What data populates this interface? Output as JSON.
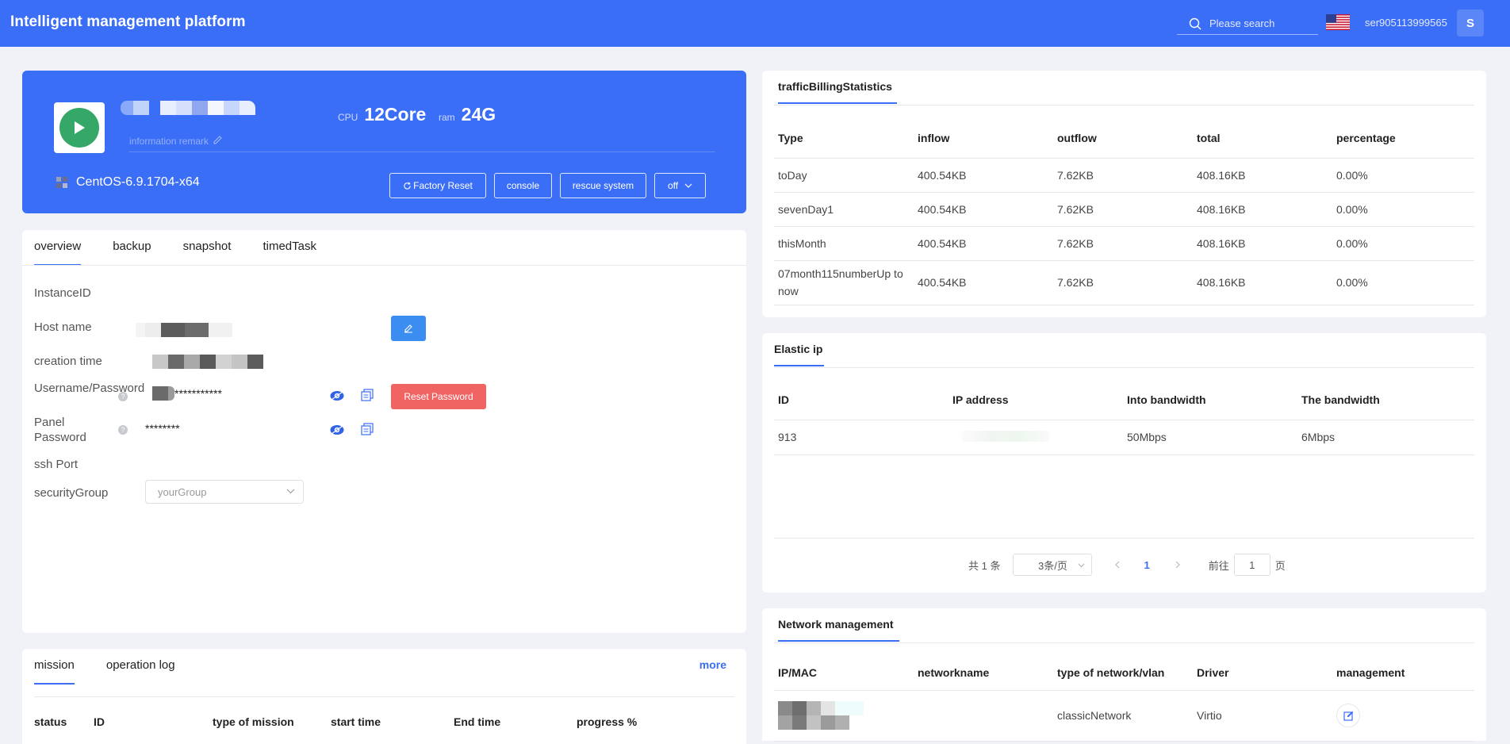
{
  "header": {
    "title": "Intelligent management platform",
    "search_placeholder": "Please search",
    "username": "ser905113999565",
    "avatar_letter": "S"
  },
  "instance": {
    "remark_label": "information remark",
    "cpu_label": "CPU",
    "cpu_value": "12Core",
    "ram_label": "ram",
    "ram_value": "24G",
    "os": "CentOS-6.9.1704-x64",
    "buttons": {
      "factory_reset": "Factory Reset",
      "console": "console",
      "rescue": "rescue system",
      "power": "off"
    }
  },
  "detail_tabs": [
    "overview",
    "backup",
    "snapshot",
    "timedTask"
  ],
  "overview": {
    "instance_id_label": "InstanceID",
    "host_name_label": "Host name",
    "creation_time_label": "creation time",
    "username_password_label": "Username/Password",
    "password_mask": "***********",
    "reset_password": "Reset Password",
    "panel_password_label": "Panel Password",
    "panel_password_mask": "********",
    "ssh_port_label": "ssh Port",
    "security_group_label": "securityGroup",
    "security_group_value": "yourGroup"
  },
  "mission_tabs": [
    "mission",
    "operation log"
  ],
  "mission_more": "more",
  "mission_columns": [
    "status",
    "ID",
    "type of mission",
    "start time",
    "End time",
    "progress %"
  ],
  "traffic": {
    "title": "trafficBillingStatistics",
    "columns": [
      "Type",
      "inflow",
      "outflow",
      "total",
      "percentage"
    ],
    "rows": [
      [
        "toDay",
        "400.54KB",
        "7.62KB",
        "408.16KB",
        "0.00%"
      ],
      [
        "sevenDay1",
        "400.54KB",
        "7.62KB",
        "408.16KB",
        "0.00%"
      ],
      [
        "thisMonth",
        "400.54KB",
        "7.62KB",
        "408.16KB",
        "0.00%"
      ],
      [
        "07month115numberUp to now",
        "400.54KB",
        "7.62KB",
        "408.16KB",
        "0.00%"
      ]
    ]
  },
  "elastic": {
    "title": "Elastic ip",
    "columns": [
      "ID",
      "IP address",
      "Into bandwidth",
      "The bandwidth"
    ],
    "rows": [
      [
        "913",
        "",
        "50Mbps",
        "6Mbps"
      ]
    ],
    "pager": {
      "total": "共 1 条",
      "page_size": "3条/页",
      "current": "1",
      "goto_prefix": "前往",
      "goto_value": "1",
      "goto_suffix": "页"
    }
  },
  "network": {
    "title": "Network management",
    "columns": [
      "IP/MAC",
      "networkname",
      "type of network/vlan",
      "Driver",
      "management"
    ],
    "rows": [
      [
        "",
        "",
        "classicNetwork",
        "Virtio",
        ""
      ]
    ]
  }
}
